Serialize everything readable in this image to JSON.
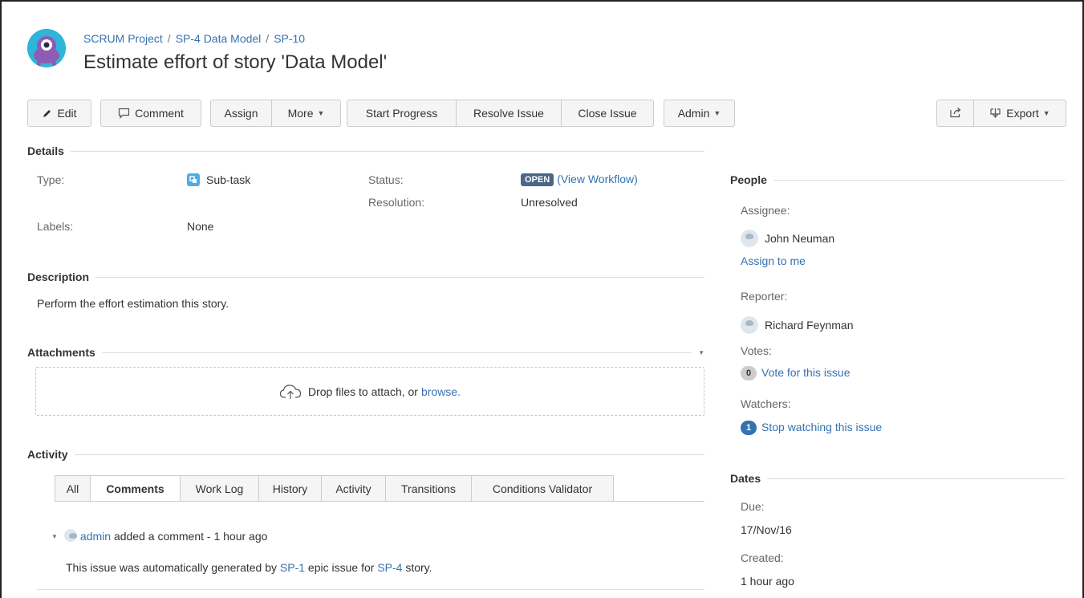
{
  "breadcrumb": {
    "project": "SCRUM Project",
    "parent": "SP-4 Data Model",
    "issue_key": "SP-10",
    "sep": "/"
  },
  "issue": {
    "title": "Estimate effort of story 'Data Model'"
  },
  "toolbar": {
    "edit": "Edit",
    "comment": "Comment",
    "assign": "Assign",
    "more": "More",
    "start_progress": "Start Progress",
    "resolve_issue": "Resolve Issue",
    "close_issue": "Close Issue",
    "admin": "Admin",
    "export": "Export"
  },
  "details": {
    "heading": "Details",
    "type_label": "Type:",
    "type_value": "Sub-task",
    "status_label": "Status:",
    "status_badge": "OPEN",
    "view_workflow": "(View Workflow)",
    "resolution_label": "Resolution:",
    "resolution_value": "Unresolved",
    "labels_label": "Labels:",
    "labels_value": "None"
  },
  "description": {
    "heading": "Description",
    "text": "Perform the effort estimation this story."
  },
  "attachments": {
    "heading": "Attachments",
    "drop_text": "Drop files to attach, or ",
    "browse": "browse."
  },
  "activity": {
    "heading": "Activity",
    "tabs": [
      "All",
      "Comments",
      "Work Log",
      "History",
      "Activity",
      "Transitions",
      "Conditions Validator"
    ],
    "active_tab": "Comments",
    "comment": {
      "author": "admin",
      "meta": " added a comment - 1 hour ago",
      "body_pre": "This issue was automatically generated by ",
      "link1": "SP-1",
      "body_mid": " epic issue for ",
      "link2": "SP-4",
      "body_post": " story."
    }
  },
  "people": {
    "heading": "People",
    "assignee_label": "Assignee:",
    "assignee": "John Neuman",
    "assign_to_me": "Assign to me",
    "reporter_label": "Reporter:",
    "reporter": "Richard Feynman",
    "votes_label": "Votes:",
    "votes_count": "0",
    "vote_link": "Vote for this issue",
    "watchers_label": "Watchers:",
    "watchers_count": "1",
    "watch_link": "Stop watching this issue"
  },
  "dates": {
    "heading": "Dates",
    "due_label": "Due:",
    "due_value": "17/Nov/16",
    "created_label": "Created:",
    "created_value": "1 hour ago"
  },
  "colors": {
    "link": "#3572b0",
    "status_badge": "#4a6785",
    "watch_badge": "#3572b0",
    "subtask_icon": "#4bade8",
    "project_avatar": "#2fb5d8"
  }
}
